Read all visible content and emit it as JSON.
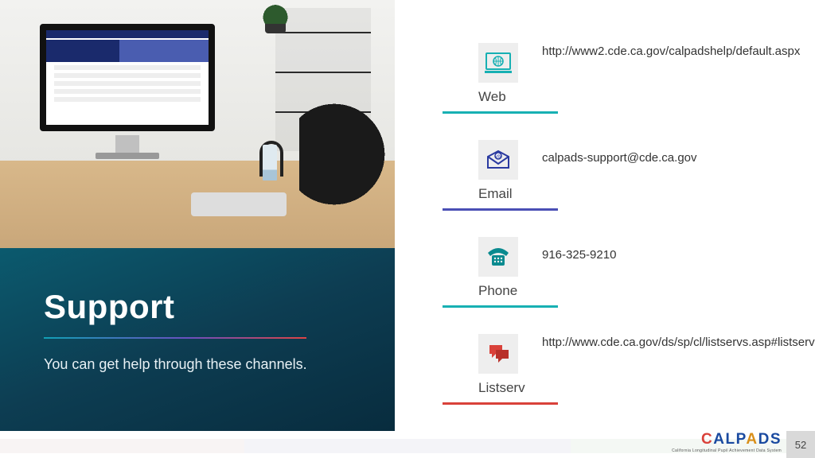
{
  "left": {
    "title": "Support",
    "subtitle": "You can get help through these channels."
  },
  "channels": [
    {
      "label": "Web",
      "text": "http://www2.cde.ca.gov/calpadshelp/default.aspx",
      "iconColor": "#17b0b3"
    },
    {
      "label": "Email",
      "text": "calpads-support@cde.ca.gov",
      "iconColor": "#2a3aa0"
    },
    {
      "label": "Phone",
      "text": "916-325-9210",
      "iconColor": "#0a8a8f"
    },
    {
      "label": "Listserv",
      "text": "http://www.cde.ca.gov/ds/sp/cl/listservs.asp#listservs",
      "iconColor": "#d9413a"
    }
  ],
  "footer": {
    "logo": "CALPADS",
    "logoSub": "California Longitudinal Pupil Achievement Data System",
    "page": "52"
  }
}
